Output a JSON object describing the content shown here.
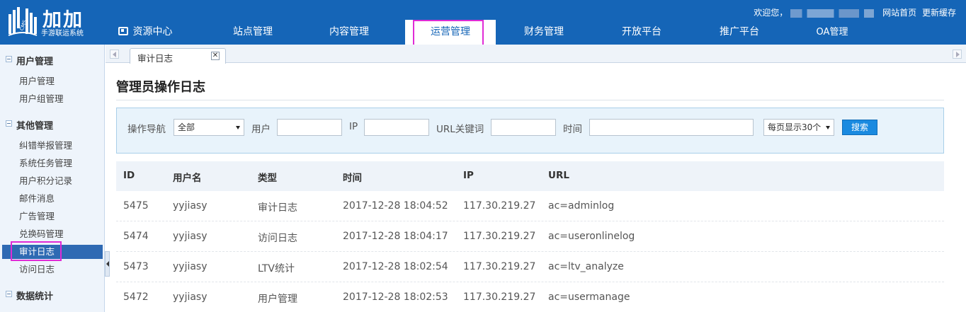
{
  "header": {
    "logo_title": "加加",
    "logo_sub": "手游联运系统",
    "logo_mark": "CMS",
    "welcome": "欢迎您，",
    "links": [
      "网站首页",
      "更新缓存"
    ]
  },
  "nav": {
    "items": [
      "资源中心",
      "站点管理",
      "内容管理",
      "运营管理",
      "财务管理",
      "开放平台",
      "推广平台",
      "OA管理"
    ],
    "active_index": 3
  },
  "sidebar": {
    "groups": [
      {
        "label": "用户管理",
        "items": [
          "用户管理",
          "用户组管理"
        ]
      },
      {
        "label": "其他管理",
        "items": [
          "纠错举报管理",
          "系统任务管理",
          "用户积分记录",
          "邮件消息",
          "广告管理",
          "兑换码管理",
          "审计日志",
          "访问日志"
        ]
      },
      {
        "label": "数据统计",
        "items": []
      }
    ],
    "active_item": "审计日志"
  },
  "tabs": [
    {
      "label": "审计日志",
      "close": "✕"
    }
  ],
  "page": {
    "title": "管理员操作日志"
  },
  "filter": {
    "nav_label": "操作导航",
    "nav_value": "全部",
    "user_label": "用户",
    "user_value": "",
    "ip_label": "IP",
    "ip_value": "",
    "url_label": "URL关键词",
    "url_value": "",
    "time_label": "时间",
    "time_value": "",
    "per_page": "每页显示30个",
    "search_label": "搜索"
  },
  "table": {
    "columns": [
      "ID",
      "用户名",
      "类型",
      "时间",
      "IP",
      "URL"
    ],
    "rows": [
      [
        "5475",
        "yyjiasy",
        "审计日志",
        "2017-12-28 18:04:52",
        "117.30.219.27",
        "ac=adminlog"
      ],
      [
        "5474",
        "yyjiasy",
        "访问日志",
        "2017-12-28 18:04:17",
        "117.30.219.27",
        "ac=useronlinelog"
      ],
      [
        "5473",
        "yyjiasy",
        "LTV统计",
        "2017-12-28 18:02:54",
        "117.30.219.27",
        "ac=ltv_analyze"
      ],
      [
        "5472",
        "yyjiasy",
        "用户管理",
        "2017-12-28 18:02:53",
        "117.30.219.27",
        "ac=usermanage"
      ]
    ]
  },
  "colors": {
    "header_bg": "#1565b7",
    "highlight": "#e02bd6",
    "sidebar_active": "#2f6ab3",
    "search_button": "#1a8ae0"
  }
}
